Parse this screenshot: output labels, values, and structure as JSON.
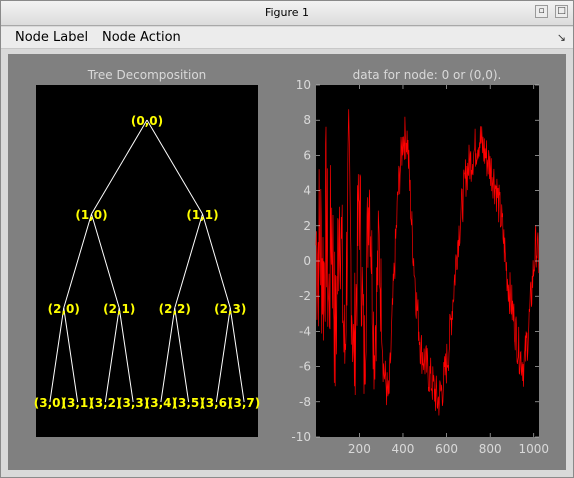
{
  "window": {
    "title": "Figure 1"
  },
  "menubar": {
    "items": [
      "Node Label",
      "Node Action"
    ]
  },
  "tree": {
    "title": "Tree Decomposition",
    "node_color": "#ffff00",
    "nodes": [
      "(0,0)",
      "(1,0)",
      "(1,1)",
      "(2,0)",
      "(2,1)",
      "(2,2)",
      "(2,3)",
      "(3,0)",
      "(3,1)",
      "(3,2)",
      "(3,3)",
      "(3,4)",
      "(3,5)",
      "(3,6)",
      "(3,7)"
    ]
  },
  "chart_data": {
    "type": "line",
    "title": "data for node: 0 or (0,0).",
    "xlabel": "",
    "ylabel": "",
    "xlim": [
      1,
      1024
    ],
    "ylim": [
      -10,
      10
    ],
    "xticks": [
      200,
      400,
      600,
      800,
      1000
    ],
    "yticks": [
      -10,
      -8,
      -6,
      -4,
      -2,
      0,
      2,
      4,
      6,
      8,
      10
    ],
    "series": [
      {
        "color": "#ff0000",
        "envelope": [
          [
            0,
            1
          ],
          [
            24,
            1
          ],
          [
            36,
            -1
          ],
          [
            48,
            3
          ],
          [
            60,
            -3
          ],
          [
            72,
            3
          ],
          [
            90,
            -5
          ],
          [
            110,
            4
          ],
          [
            132,
            -6
          ],
          [
            150,
            5
          ],
          [
            175,
            -6
          ],
          [
            200,
            4
          ],
          [
            222,
            -6
          ],
          [
            245,
            5
          ],
          [
            268,
            -5
          ],
          [
            290,
            1
          ],
          [
            310,
            -6
          ],
          [
            335,
            -8
          ],
          [
            355,
            -2
          ],
          [
            378,
            4
          ],
          [
            400,
            7
          ],
          [
            420,
            7
          ],
          [
            440,
            2
          ],
          [
            460,
            -2
          ],
          [
            482,
            -5
          ],
          [
            508,
            -6
          ],
          [
            535,
            -7
          ],
          [
            560,
            -8
          ],
          [
            585,
            -7
          ],
          [
            610,
            -5
          ],
          [
            630,
            -2
          ],
          [
            650,
            1
          ],
          [
            670,
            3
          ],
          [
            690,
            5
          ],
          [
            720,
            6
          ],
          [
            750,
            7
          ],
          [
            780,
            6
          ],
          [
            810,
            5
          ],
          [
            830,
            4
          ],
          [
            855,
            2
          ],
          [
            880,
            -1
          ],
          [
            905,
            -3
          ],
          [
            930,
            -5
          ],
          [
            955,
            -6
          ],
          [
            975,
            -4
          ],
          [
            995,
            -1
          ],
          [
            1010,
            1
          ],
          [
            1024,
            0
          ]
        ]
      }
    ],
    "axes_color": "#000000",
    "tick_label_color": "#d9d9d9"
  }
}
